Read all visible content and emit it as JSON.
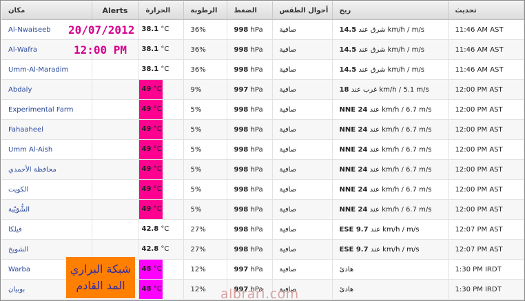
{
  "header": {
    "location": "مكان",
    "alerts": "Alerts",
    "temperature": "الحرارة",
    "humidity": "الرطوبة",
    "pressure": "الضغط",
    "conditions": "أحوال الطقس",
    "wind": "ريح",
    "updated": "تحديث"
  },
  "rows": [
    {
      "location": "Al-Nwaiseeb",
      "temp": "38.1",
      "temp_unit": "°C",
      "hum": "36%",
      "press": "998",
      "press_unit": "hPa",
      "cond": "صافية",
      "wind_bold": "14.5",
      "wind_rest": " شرق عند km/h  /  m/s",
      "updated": "11:46 AM AST"
    },
    {
      "location": "Al-Wafra",
      "temp": "38.1",
      "temp_unit": "°C",
      "hum": "36%",
      "press": "998",
      "press_unit": "hPa",
      "cond": "صافية",
      "wind_bold": "14.5",
      "wind_rest": " شرق عند km/h  /  m/s",
      "updated": "11:46 AM AST"
    },
    {
      "location": "Umm-Al-Maradim",
      "temp": "38.1",
      "temp_unit": "°C",
      "hum": "36%",
      "press": "998",
      "press_unit": "hPa",
      "cond": "صافية",
      "wind_bold": "14.5",
      "wind_rest": " شرق عند km/h  /  m/s",
      "updated": "11:46 AM AST"
    },
    {
      "location": "Abdaly",
      "temp": "49",
      "temp_unit": "°C",
      "hum": "9%",
      "press": "997",
      "press_unit": "hPa",
      "cond": "صافية",
      "wind_bold": "18",
      "wind_rest": " غرب عند km/h / 5.1 m/s",
      "updated": "12:00 PM AST"
    },
    {
      "location": "Experimental Farm",
      "temp": "49",
      "temp_unit": "°C",
      "hum": "5%",
      "press": "998",
      "press_unit": "hPa",
      "cond": "صافية",
      "wind_bold": "NNE 24",
      "wind_rest": " عند km/h / 6.7 m/s",
      "updated": "12:00 PM AST"
    },
    {
      "location": "Fahaaheel",
      "temp": "49",
      "temp_unit": "°C",
      "hum": "5%",
      "press": "998",
      "press_unit": "hPa",
      "cond": "صافية",
      "wind_bold": "NNE 24",
      "wind_rest": " عند km/h / 6.7 m/s",
      "updated": "12:00 PM AST"
    },
    {
      "location": "Umm Al-Aish",
      "temp": "49",
      "temp_unit": "°C",
      "hum": "5%",
      "press": "998",
      "press_unit": "hPa",
      "cond": "صافية",
      "wind_bold": "NNE 24",
      "wind_rest": " عند km/h / 6.7 m/s",
      "updated": "12:00 PM AST"
    },
    {
      "location": "محافظة الأحمدي",
      "temp": "49",
      "temp_unit": "°C",
      "hum": "5%",
      "press": "998",
      "press_unit": "hPa",
      "cond": "صافية",
      "wind_bold": "NNE 24",
      "wind_rest": " عند km/h / 6.7 m/s",
      "updated": "12:00 PM AST"
    },
    {
      "location": "الكويت",
      "temp": "49",
      "temp_unit": "°C",
      "hum": "5%",
      "press": "998",
      "press_unit": "hPa",
      "cond": "صافية",
      "wind_bold": "NNE 24",
      "wind_rest": " عند km/h / 6.7 m/s",
      "updated": "12:00 PM AST"
    },
    {
      "location": "الشُّوَيْبة",
      "temp": "49",
      "temp_unit": "°C",
      "hum": "5%",
      "press": "998",
      "press_unit": "hPa",
      "cond": "صافية",
      "wind_bold": "NNE 24",
      "wind_rest": " عند km/h / 6.7 m/s",
      "updated": "12:00 PM AST"
    },
    {
      "location": "فيلكا",
      "temp": "42.8",
      "temp_unit": "°C",
      "hum": "27%",
      "press": "998",
      "press_unit": "hPa",
      "cond": "صافية",
      "wind_bold": "ESE 9.7",
      "wind_rest": " عند km/h  /  m/s",
      "updated": "12:07 PM AST"
    },
    {
      "location": "الشويخ",
      "temp": "42.8",
      "temp_unit": "°C",
      "hum": "27%",
      "press": "998",
      "press_unit": "hPa",
      "cond": "صافية",
      "wind_bold": "ESE 9.7",
      "wind_rest": " عند km/h  /  m/s",
      "updated": "12:07 PM AST"
    },
    {
      "location": "Warba",
      "temp": "48",
      "temp_unit": "°C",
      "hum": "12%",
      "press": "997",
      "press_unit": "hPa",
      "cond": "صافية",
      "wind_bold": "",
      "wind_rest": "هادئ",
      "updated": "1:30 PM IRDT"
    },
    {
      "location": "بوبيان",
      "temp": "48",
      "temp_unit": "°C",
      "hum": "12%",
      "press": "997",
      "press_unit": "hPa",
      "cond": "صافية",
      "wind_bold": "",
      "wind_rest": "هادئ",
      "updated": "1:30 PM IRDT"
    }
  ],
  "overlay": {
    "date": "20/07/2012",
    "time": "12:00 PM",
    "badge_line1": "شبكة البراري",
    "badge_line2": "المد القادم",
    "watermark": "albrari.com"
  },
  "colors": {
    "hot_highlight": "#ff0090",
    "warm_highlight": "#ff00ff",
    "overlay_text": "#d6008f",
    "badge_bg": "#ff7f00",
    "badge_text": "#2a2aaa",
    "link": "#2b4a9b"
  }
}
